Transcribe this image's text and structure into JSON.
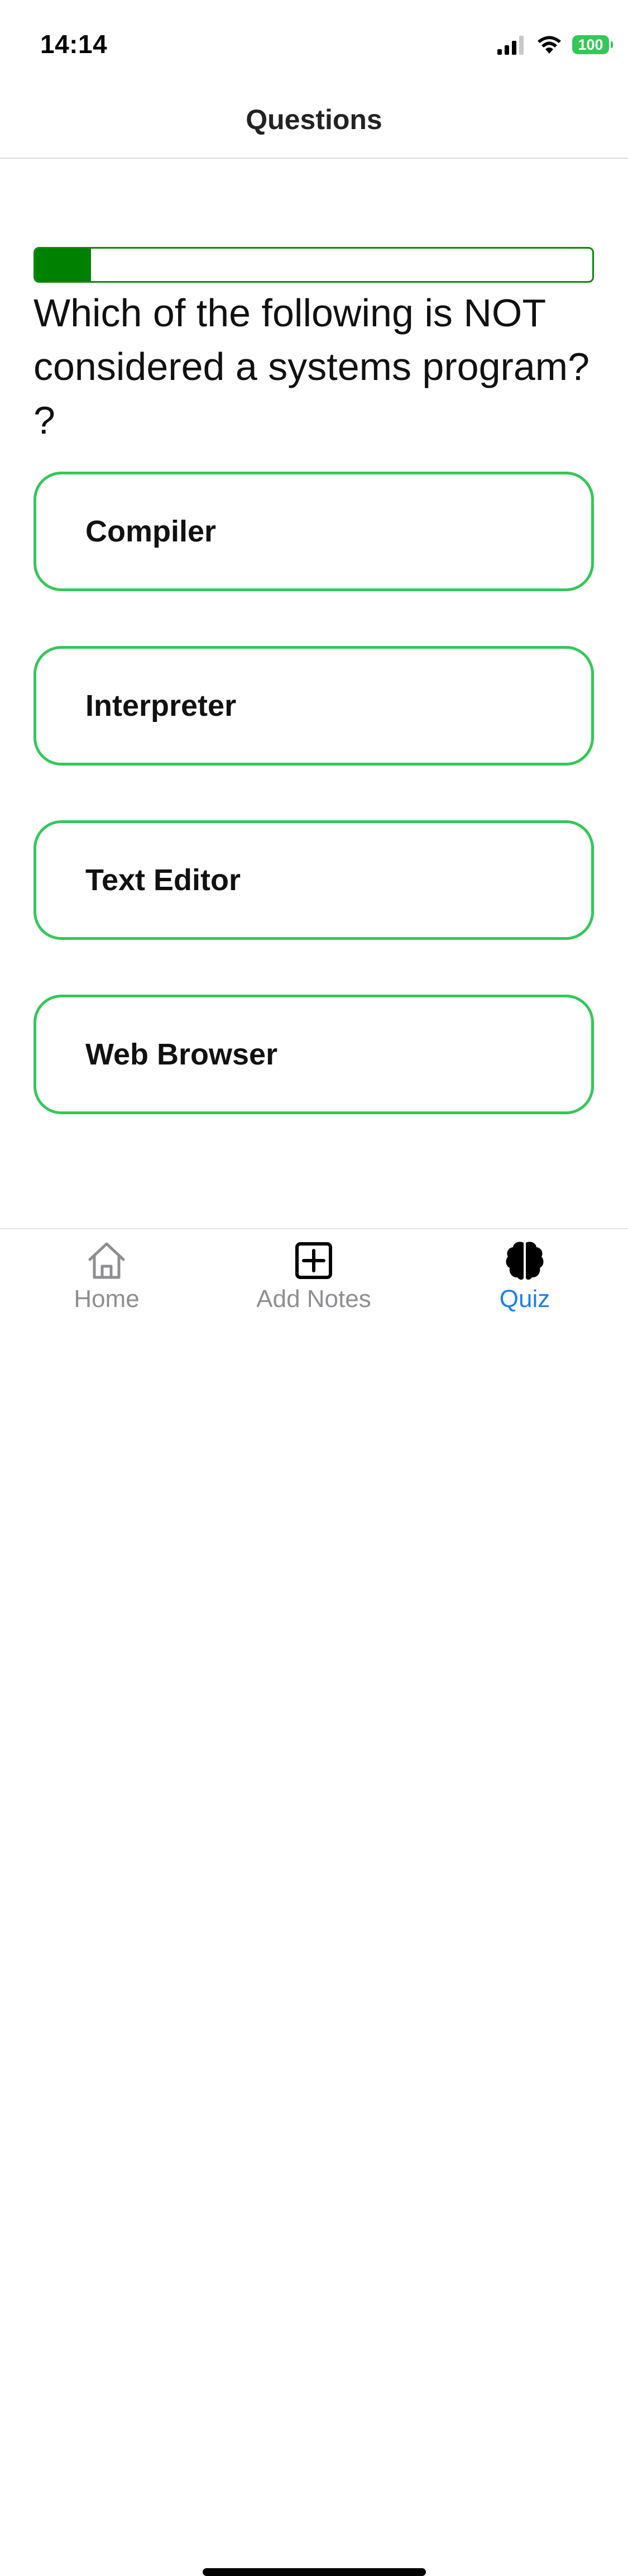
{
  "status_bar": {
    "time": "14:14",
    "battery": "100",
    "icons": [
      "signal-icon",
      "wifi-icon",
      "battery-icon"
    ]
  },
  "nav": {
    "title": "Questions"
  },
  "quiz": {
    "progress_fraction": 0.1,
    "question": "Which of the following is NOT considered a systems program? ?",
    "answers": [
      {
        "label": "Compiler"
      },
      {
        "label": "Interpreter"
      },
      {
        "label": "Text Editor"
      },
      {
        "label": "Web Browser"
      }
    ],
    "colors": {
      "progress_fill": "#008000",
      "answer_border": "#34c759"
    }
  },
  "tab_bar": {
    "tabs": [
      {
        "label": "Home",
        "icon": "home-icon",
        "active": false
      },
      {
        "label": "Add Notes",
        "icon": "plus-square-icon",
        "active": false
      },
      {
        "label": "Quiz",
        "icon": "brain-icon",
        "active": true
      }
    ],
    "colors": {
      "active": "#1a7ff0",
      "inactive": "#8e8e93"
    }
  }
}
